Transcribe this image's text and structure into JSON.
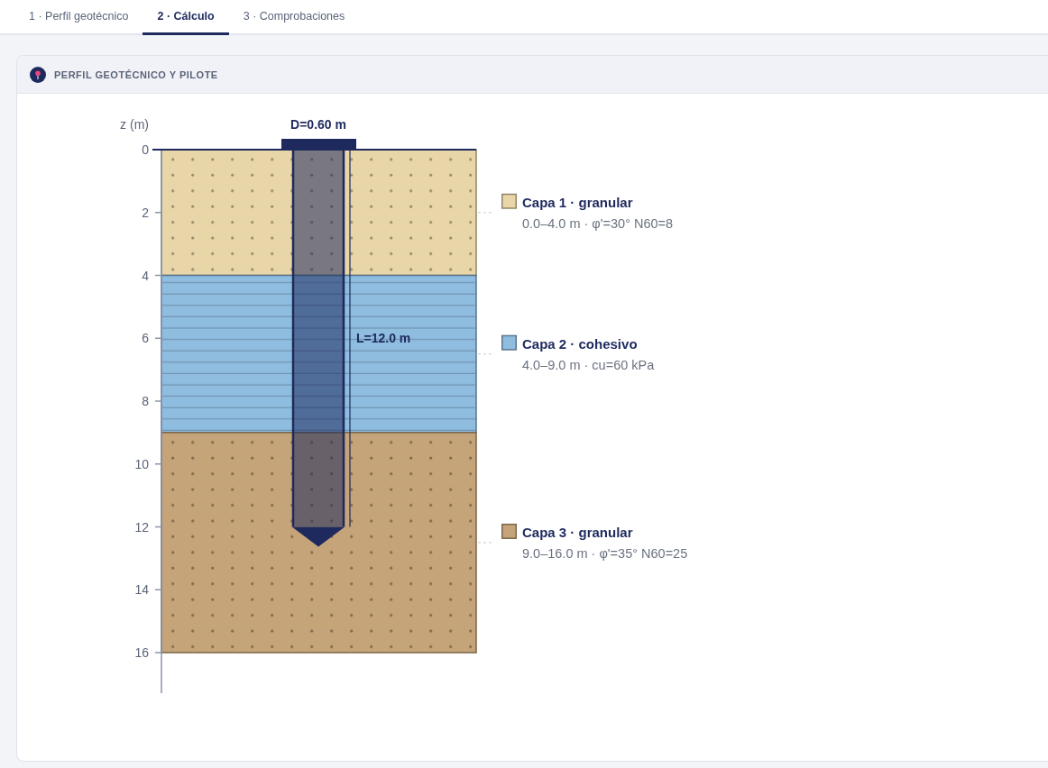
{
  "tabs": [
    {
      "label": "1 · Perfil geotécnico",
      "selected": false
    },
    {
      "label": "2 · Cálculo",
      "selected": true
    },
    {
      "label": "3 · Comprobaciones",
      "selected": false
    }
  ],
  "panel": {
    "title": "PERFIL GEOTÉCNICO Y PILOTE",
    "profile": {
      "axis_label": "z (m)",
      "depth_ticks": [
        "0",
        "2",
        "4",
        "6",
        "8",
        "10",
        "12",
        "14",
        "16"
      ],
      "layers": [
        {
          "title": "Capa 1 · granular",
          "details": "0.0–4.0 m · φ'=30° N60=8",
          "kind": "granular",
          "color": "#e8d6a8"
        },
        {
          "title": "Capa 2 · cohesivo",
          "details": "4.0–9.0 m · cu=60 kPa",
          "kind": "cohesive",
          "color": "#8fbde0"
        },
        {
          "title": "Capa 3 · granular",
          "details": "9.0–16.0 m · φ'=35° N60=25",
          "kind": "granular",
          "color": "#c4a478"
        }
      ],
      "pile": {
        "diameter_label": "D=0.60 m",
        "length_label": "L=12.0 m"
      }
    }
  }
}
